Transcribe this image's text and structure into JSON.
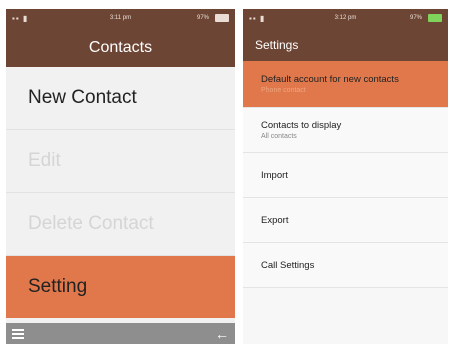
{
  "left": {
    "status": {
      "signal": "▪▪ ▮",
      "time": "3:11 pm",
      "battery": "97%"
    },
    "title": "Contacts",
    "items": [
      {
        "label": "New Contact",
        "state": "normal"
      },
      {
        "label": "Edit",
        "state": "disabled"
      },
      {
        "label": "Delete Contact",
        "state": "disabled"
      },
      {
        "label": "Setting",
        "state": "active"
      }
    ],
    "bottom": {
      "menu_icon": "menu-icon",
      "back_icon": "arrow-left-icon",
      "back_glyph": "←"
    }
  },
  "right": {
    "status": {
      "signal": "▪▪ ▮",
      "time": "3:12 pm",
      "battery": "97%"
    },
    "title": "Settings",
    "rows": [
      {
        "label": "Default account for new contacts",
        "sub": "Phone contact"
      },
      {
        "label": "Contacts to display",
        "sub": "All contacts"
      },
      {
        "label": "Import",
        "sub": ""
      },
      {
        "label": "Export",
        "sub": ""
      },
      {
        "label": "Call Settings",
        "sub": ""
      }
    ]
  },
  "colors": {
    "header": "#6d4534",
    "accent": "#e0784c",
    "bottombar": "#8e8e8e",
    "battery_charging": "#7fd35b"
  }
}
